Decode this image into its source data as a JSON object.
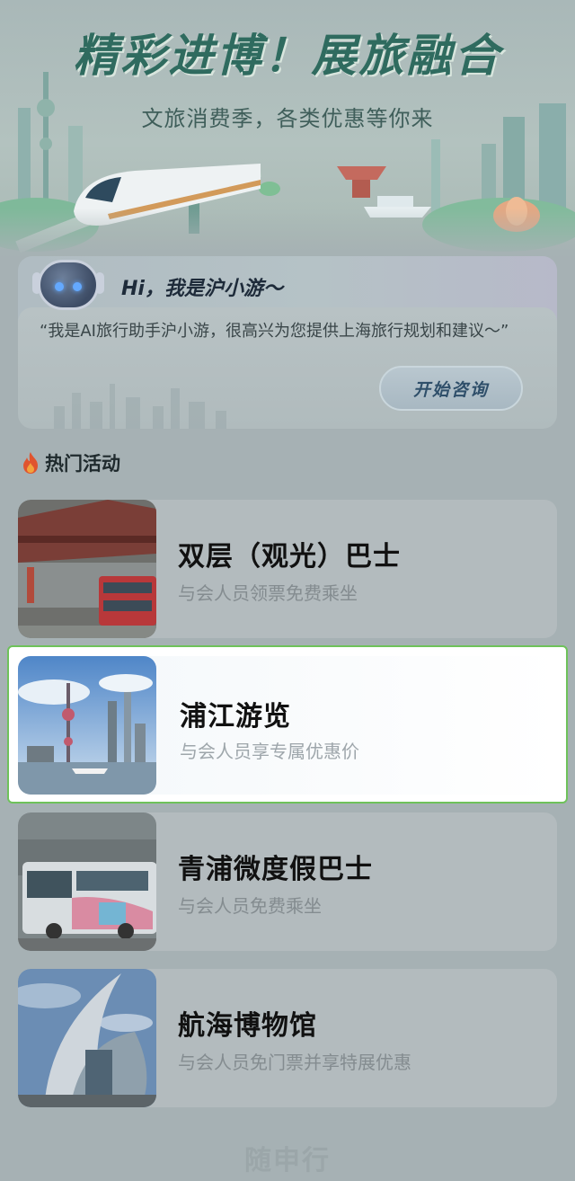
{
  "banner": {
    "title": "精彩进博！展旅融合",
    "subtitle": "文旅消费季，各类优惠等你来"
  },
  "assistant": {
    "greeting": "Hi，我是沪小游～",
    "intro": "“我是AI旅行助手沪小游，很高兴为您提供上海旅行规划和建议～”",
    "consult_button": "开始咨询",
    "avatar_icon": "robot-icon"
  },
  "section": {
    "icon": "fire-icon",
    "title": "热门活动"
  },
  "activities": [
    {
      "title": "双层（观光）巴士",
      "desc": "与会人员领票免费乘坐",
      "image": "yu-garden-double-decker-bus"
    },
    {
      "title": "浦江游览",
      "desc": "与会人员享专属优惠价",
      "image": "pudong-skyline-river",
      "selected": true
    },
    {
      "title": "青浦微度假巴士",
      "desc": "与会人员免费乘坐",
      "image": "qingpu-bus"
    },
    {
      "title": "航海博物馆",
      "desc": "与会人员免门票并享特展优惠",
      "image": "maritime-museum"
    }
  ],
  "footer": {
    "logo_text": "随申行"
  },
  "colors": {
    "highlight_border": "#6ec25a",
    "title_green": "#2f6b5f"
  }
}
